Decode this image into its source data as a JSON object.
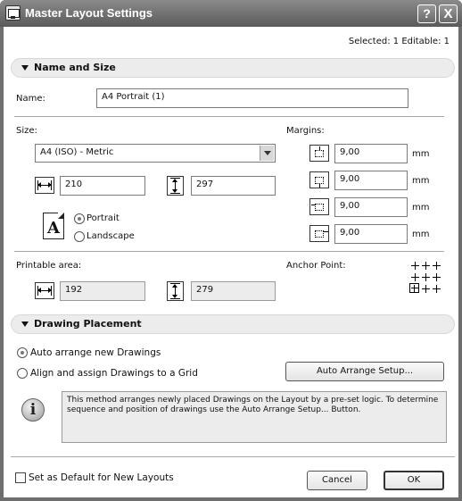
{
  "window": {
    "title": "Master Layout Settings",
    "help_glyph": "?",
    "close_glyph": "X"
  },
  "selection_info": "Selected: 1 Editable: 1",
  "sections": {
    "name_and_size": "Name and Size",
    "drawing_placement": "Drawing Placement"
  },
  "name": {
    "label": "Name:",
    "value": "A4 Portrait (1)"
  },
  "size": {
    "label": "Size:",
    "preset": "A4 (ISO) - Metric",
    "width": "210",
    "height": "297",
    "page_glyph": "A",
    "orientation": {
      "portrait": "Portrait",
      "landscape": "Landscape",
      "selected": "portrait"
    }
  },
  "margins": {
    "label": "Margins:",
    "unit": "mm",
    "top": "9,00",
    "bottom": "9,00",
    "left": "9,00",
    "right": "9,00"
  },
  "printable_area": {
    "label": "Printable area:",
    "width": "192",
    "height": "279"
  },
  "anchor_point": {
    "label": "Anchor Point:",
    "selected": "bottom-left"
  },
  "placement": {
    "auto_arrange_label": "Auto arrange new Drawings",
    "grid_label": "Align and assign Drawings to a Grid",
    "selected": "auto",
    "setup_button": "Auto Arrange Setup...",
    "info_text": "This method arranges newly placed Drawings on the Layout by a pre-set logic. To determine sequence and position of drawings use the Auto Arrange Setup... Button."
  },
  "footer": {
    "default_checkbox_label": "Set as Default for New Layouts",
    "cancel_label": "Cancel",
    "ok_label": "OK"
  }
}
